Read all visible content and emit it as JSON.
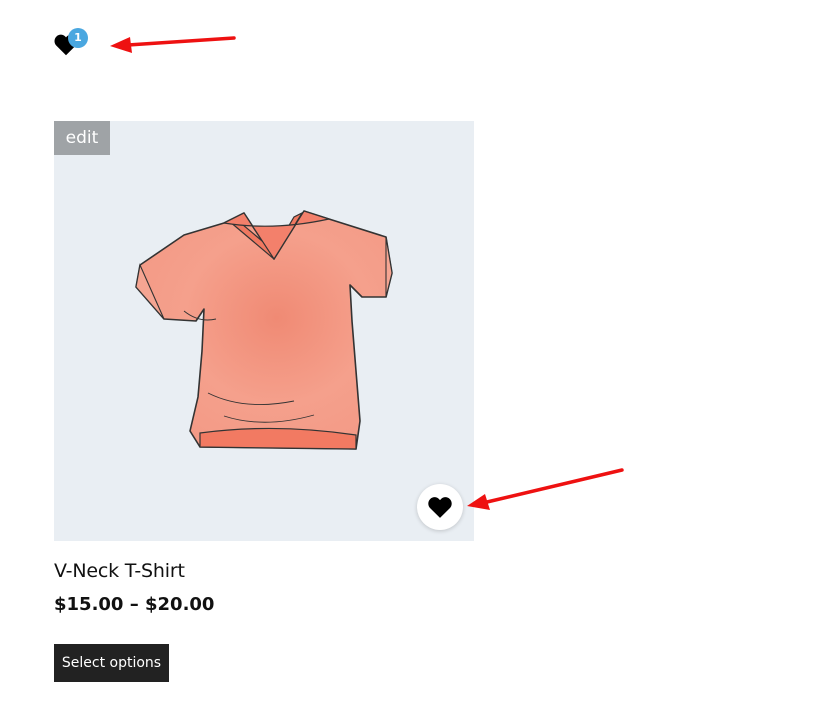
{
  "colors": {
    "badge": "#4aa7e0",
    "heart": "#000000",
    "image_bg": "#e9eef3",
    "edit_bg": "#9fa3a6",
    "button_bg": "#222222",
    "arrow": "#ee1111",
    "tshirt": "#f39a86"
  },
  "header": {
    "wishlist_icon": "heart-icon",
    "wishlist_count": "1"
  },
  "product": {
    "edit_label": "edit",
    "image_icon": "tshirt-image",
    "wishlist_icon": "heart-icon",
    "title": "V-Neck T-Shirt",
    "price": "$15.00 – $20.00",
    "button_label": "Select options"
  }
}
